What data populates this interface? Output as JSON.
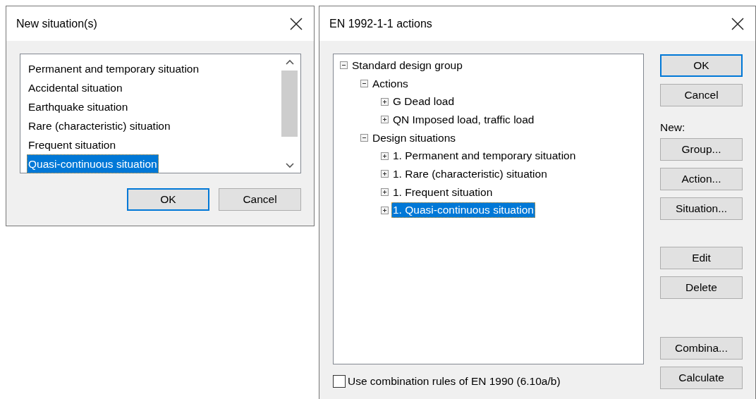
{
  "left_dialog": {
    "title": "New situation(s)",
    "list": [
      {
        "label": "Permanent and temporary situation",
        "selected": false
      },
      {
        "label": "Accidental situation",
        "selected": false
      },
      {
        "label": "Earthquake situation",
        "selected": false
      },
      {
        "label": "Rare (characteristic) situation",
        "selected": false
      },
      {
        "label": "Frequent situation",
        "selected": false
      },
      {
        "label": "Quasi-continuous situation",
        "selected": true
      }
    ],
    "buttons": [
      {
        "label": "OK",
        "default": true
      },
      {
        "label": "Cancel",
        "default": false
      }
    ]
  },
  "right_dialog": {
    "title": "EN 1992-1-1 actions",
    "tree": [
      {
        "label": "Standard design group",
        "expanded": true,
        "selected": false,
        "children": [
          {
            "label": "Actions",
            "expanded": true,
            "selected": false,
            "children": [
              {
                "label": "G Dead load",
                "expanded": false,
                "selected": false
              },
              {
                "label": "QN Imposed load, traffic load",
                "expanded": false,
                "selected": false
              }
            ]
          },
          {
            "label": "Design situations",
            "expanded": true,
            "selected": false,
            "children": [
              {
                "label": "1. Permanent and temporary situation",
                "expanded": false,
                "selected": false
              },
              {
                "label": "1. Rare (characteristic) situation",
                "expanded": false,
                "selected": false
              },
              {
                "label": "1. Frequent situation",
                "expanded": false,
                "selected": false
              },
              {
                "label": "1. Quasi-continuous situation",
                "expanded": false,
                "selected": true
              }
            ]
          }
        ]
      }
    ],
    "checkbox": {
      "label": "Use combination rules of EN 1990 (6.10a/b)",
      "checked": false
    },
    "side": [
      {
        "kind": "button",
        "label": "OK",
        "default": true
      },
      {
        "kind": "button",
        "label": "Cancel",
        "default": false
      },
      {
        "kind": "label",
        "label": "New:"
      },
      {
        "kind": "button",
        "label": "Group...",
        "default": false
      },
      {
        "kind": "button",
        "label": "Action...",
        "default": false
      },
      {
        "kind": "button",
        "label": "Situation...",
        "default": false
      },
      {
        "kind": "gap"
      },
      {
        "kind": "button",
        "label": "Edit",
        "default": false
      },
      {
        "kind": "button",
        "label": "Delete",
        "default": false
      },
      {
        "kind": "spacer"
      },
      {
        "kind": "button",
        "label": "Combina...",
        "default": false
      },
      {
        "kind": "button",
        "label": "Calculate",
        "default": false
      }
    ]
  }
}
